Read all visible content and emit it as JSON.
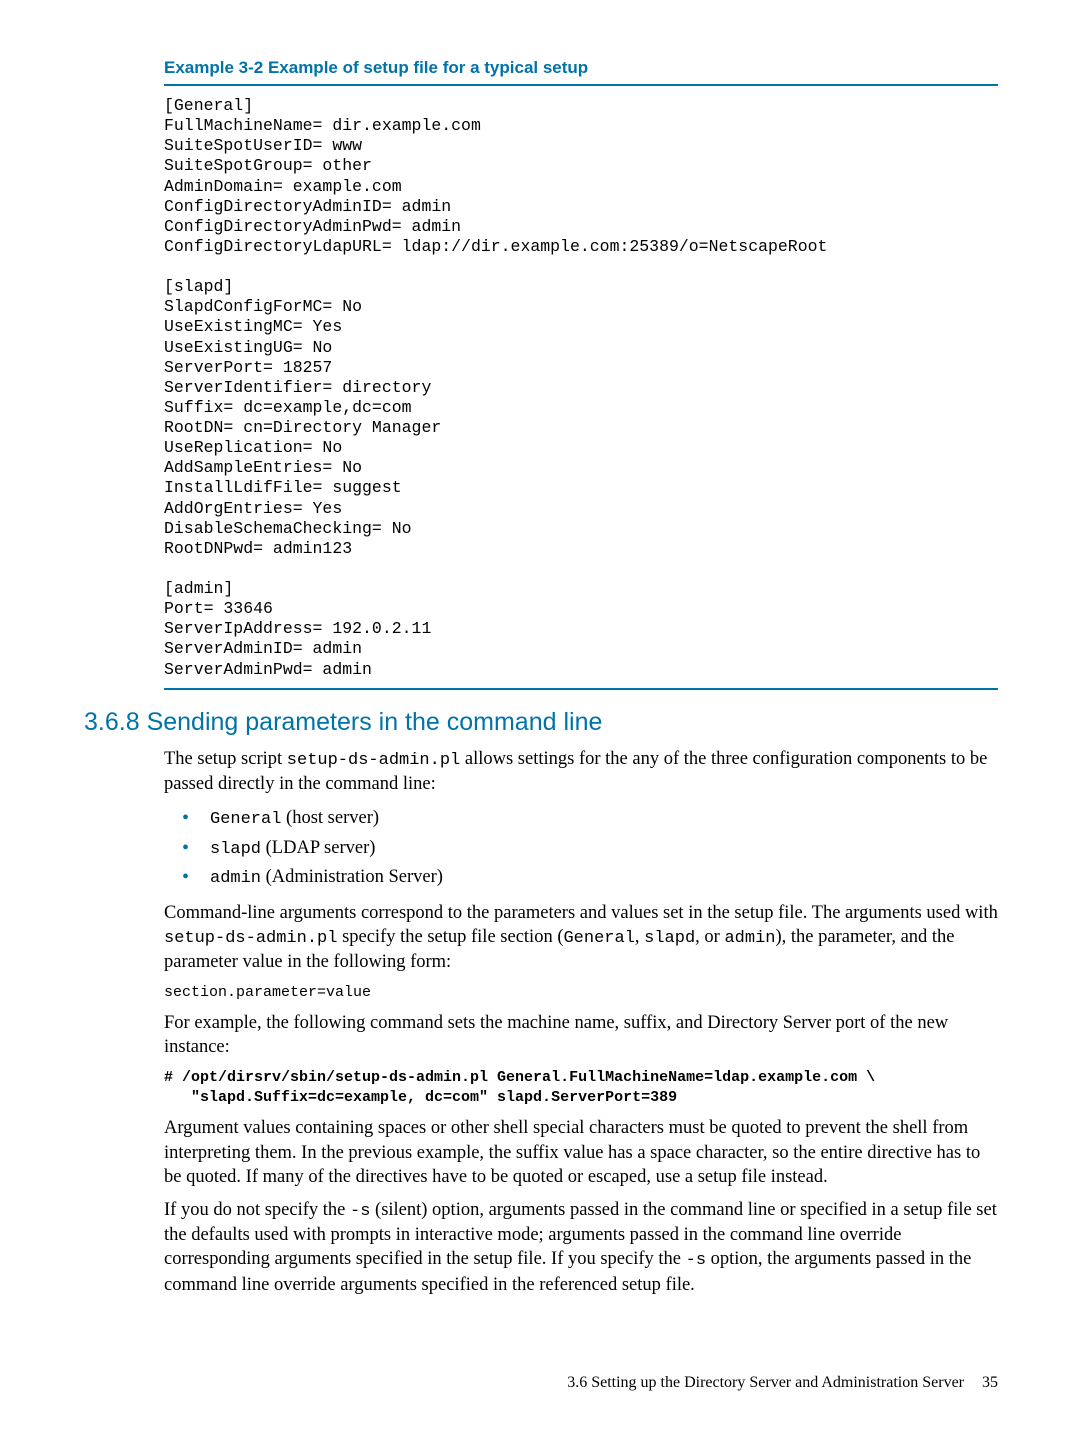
{
  "example": {
    "title": "Example 3-2 Example of setup file for a typical setup",
    "code": "[General]\nFullMachineName= dir.example.com\nSuiteSpotUserID= www\nSuiteSpotGroup= other\nAdminDomain= example.com\nConfigDirectoryAdminID= admin\nConfigDirectoryAdminPwd= admin\nConfigDirectoryLdapURL= ldap://dir.example.com:25389/o=NetscapeRoot\n\n[slapd]\nSlapdConfigForMC= No\nUseExistingMC= Yes\nUseExistingUG= No\nServerPort= 18257\nServerIdentifier= directory\nSuffix= dc=example,dc=com\nRootDN= cn=Directory Manager\nUseReplication= No\nAddSampleEntries= No\nInstallLdifFile= suggest\nAddOrgEntries= Yes\nDisableSchemaChecking= No\nRootDNPwd= admin123\n\n[admin]\nPort= 33646\nServerIpAddress= 192.0.2.11\nServerAdminID= admin\nServerAdminPwd= admin"
  },
  "section": {
    "number": "3.6.8",
    "title": "Sending parameters in the command line",
    "p1a": "The setup script ",
    "p1_code": "setup-ds-admin.pl",
    "p1b": " allows settings for the any of the three configuration components to be passed directly in the command line:",
    "bullets": {
      "b1_code": "General",
      "b1_text": " (host server)",
      "b2_code": "slapd",
      "b2_text": " (LDAP server)",
      "b3_code": "admin",
      "b3_text": " (Administration Server)"
    },
    "p2a": "Command-line arguments correspond to the parameters and values set in the setup file. The arguments used with ",
    "p2_code1": "setup-ds-admin.pl",
    "p2b": " specify the setup file section (",
    "p2_code2": "General",
    "p2c": ", ",
    "p2_code3": "slapd",
    "p2d": ", or ",
    "p2_code4": "admin",
    "p2e": "), the parameter, and the parameter value in the following form:",
    "form_code": "section.parameter=value",
    "p3": "For example, the following command sets the machine name, suffix, and Directory Server port of the new instance:",
    "cmd_example": "# /opt/dirsrv/sbin/setup-ds-admin.pl General.FullMachineName=ldap.example.com \\\n   \"slapd.Suffix=dc=example, dc=com\" slapd.ServerPort=389",
    "p4": "Argument values containing spaces or other shell special characters must be quoted to prevent the shell from interpreting them. In the previous example, the suffix value has a space character, so the entire directive has to be quoted. If many of the directives have to be quoted or escaped, use a setup file instead.",
    "p5a": "If you do not specify the ",
    "p5_code1": "-s",
    "p5b": " (silent) option, arguments passed in the command line or specified in a setup file set the defaults used with prompts in interactive mode; arguments passed in the command line override corresponding arguments specified in the setup file. If you specify the ",
    "p5_code2": "-s",
    "p5c": " option, the arguments passed in the command line override arguments specified in the referenced setup file."
  },
  "footer": {
    "text": "3.6 Setting up the Directory Server and Administration Server",
    "page": "35"
  }
}
